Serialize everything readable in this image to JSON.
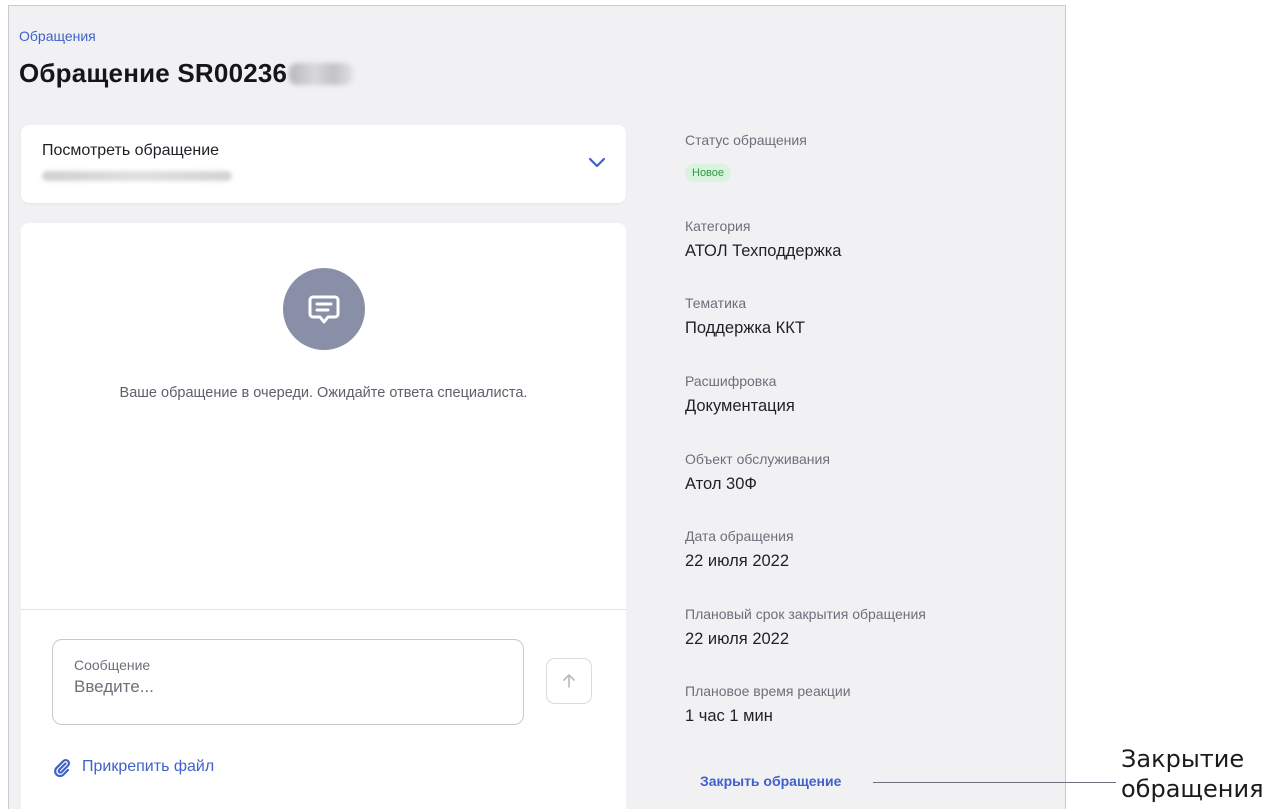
{
  "header": {
    "breadcrumb": "Обращения",
    "title": "Обращение SR00236"
  },
  "view_card": {
    "title": "Посмотреть обращение"
  },
  "chat": {
    "queue_message": "Ваше обращение в очереди. Ожидайте ответа специалиста.",
    "message_label": "Сообщение",
    "message_placeholder": "Введите...",
    "attach_label": "Прикрепить файл"
  },
  "details": {
    "status_label": "Статус обращения",
    "status_value": "Новое",
    "category_label": "Категория",
    "category_value": "АТОЛ Техподдержка",
    "topic_label": "Тематика",
    "topic_value": "Поддержка ККТ",
    "decode_label": "Расшифровка",
    "decode_value": "Документация",
    "object_label": "Объект обслуживания",
    "object_value": "Атол 30Ф",
    "date_label": "Дата обращения",
    "date_value": "22 июля 2022",
    "deadline_label": "Плановый срок закрытия обращения",
    "deadline_value": "22 июля 2022",
    "reaction_label": "Плановое время реакции",
    "reaction_value": "1 час 1 мин"
  },
  "close_link": "Закрыть обращение",
  "callout": {
    "line1": "Закрытие",
    "line2": "обращения"
  },
  "colors": {
    "accent": "#3f62c9",
    "status_green": "#2f9a47",
    "status_bg": "#d9f3de",
    "panel_bg": "#f1f1f4",
    "chat_icon_bg": "#8a8fa8"
  },
  "icons": {
    "dropdown": "chevron-down-icon",
    "chat": "chat-bubble-icon",
    "send": "arrow-up-icon",
    "attach": "paperclip-icon"
  }
}
